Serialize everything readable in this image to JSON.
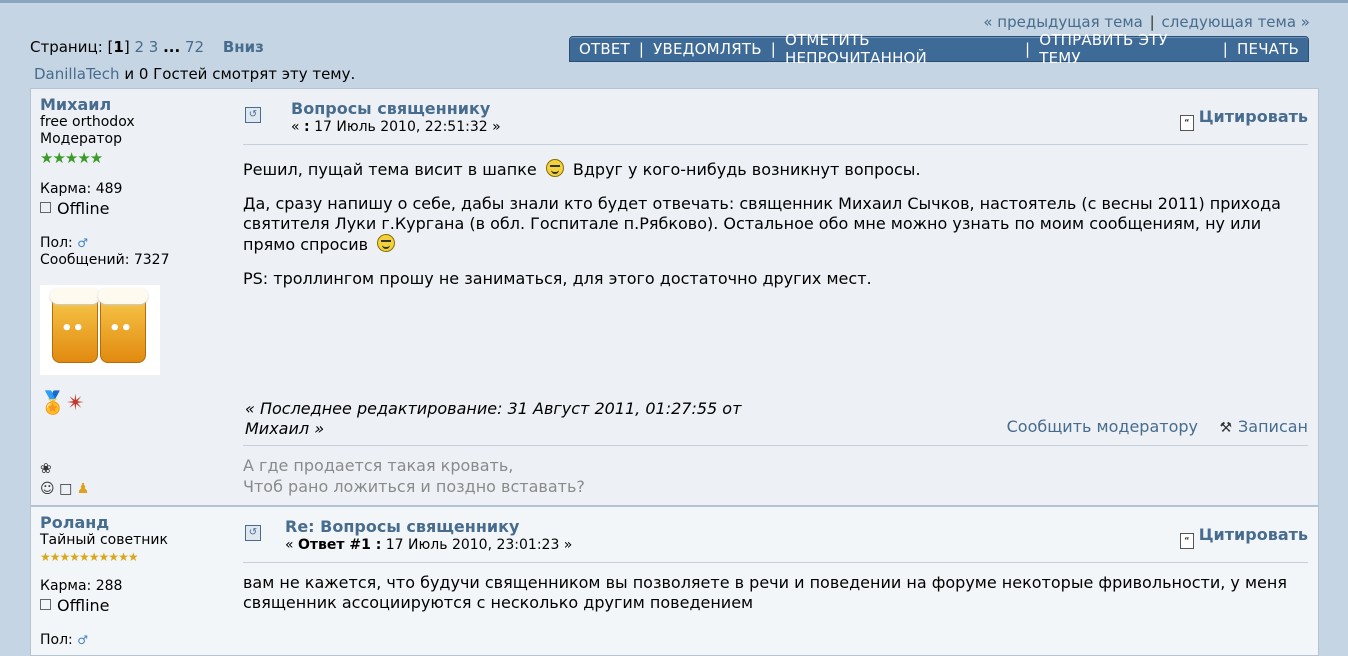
{
  "nav": {
    "prev_topic": "« предыдущая тема",
    "separator": "|",
    "next_topic": "следующая тема »"
  },
  "pages": {
    "label": "Страниц:",
    "current": "1",
    "p2": "2",
    "p3": "3",
    "ellipsis": "...",
    "last": "72",
    "down": "Вниз"
  },
  "viewers": {
    "user": "DanillaTech",
    "rest": " и 0 Гостей смотрят эту тему."
  },
  "buttons": {
    "reply": "ОТВЕТ",
    "notify": "УВЕДОМЛЯТЬ",
    "mark_unread": "ОТМЕТИТЬ НЕПРОЧИТАННОЙ",
    "send_topic": "ОТПРАВИТЬ ЭТУ ТЕМУ",
    "print": "ПЕЧАТЬ",
    "sep": "|"
  },
  "posts": [
    {
      "author": "Михаил",
      "custom_title": "free orthodox",
      "group": "Модератор",
      "stars": "★★★★★",
      "karma": "Карма: 489",
      "status": "Offline",
      "gender_label": "Пол:",
      "posts_count": "Сообщений: 7327",
      "subject": "Вопросы священнику",
      "date_prefix": "« ",
      "date_bold": ":",
      "date": " 17 Июль 2010, 22:51:32 »",
      "quote": "Цитировать",
      "body": [
        "Решил, пущай тема висит в шапке",
        "Вдруг у кого-нибудь возникнут вопросы.",
        "Да, сразу напишу о себе, дабы знали кто будет отвечать: священник Михаил Сычков, настоятель (с весны 2011) прихода святителя Луки г.Кургана (в обл. Госпитале п.Рябково). Остальное обо мне можно узнать по моим сообщениям, ну или прямо спросив",
        "PS: троллингом прошу не заниматься, для этого достаточно других мест."
      ],
      "edited": "« Последнее редактирование: 31 Август 2011, 01:27:55 от Михаил »",
      "report": "Сообщить модератору",
      "logged": "Записан",
      "signature_1": "А где продается такая кровать,",
      "signature_2": "Чтоб рано ложиться и поздно вставать?"
    },
    {
      "author": "Роланд",
      "group": "Тайный советник",
      "stars": "★★★★★★★★★★",
      "karma": "Карма: 288",
      "status": "Offline",
      "gender_label": "Пол:",
      "subject": "Re: Вопросы священнику",
      "date_prefix": "« ",
      "date_bold": "Ответ #1 :",
      "date": " 17 Июль 2010, 23:01:23 »",
      "quote": "Цитировать",
      "body": "вам не кажется, что будучи священником вы позволяете в речи и поведении на форуме некоторые фривольности, у меня священник ассоциируются с несколько другим поведением"
    }
  ],
  "icons": {
    "message": "message-icon",
    "quote": "quote-icon",
    "male": "male-icon",
    "offline": "offline-icon",
    "smiley": "smiley-icon"
  }
}
